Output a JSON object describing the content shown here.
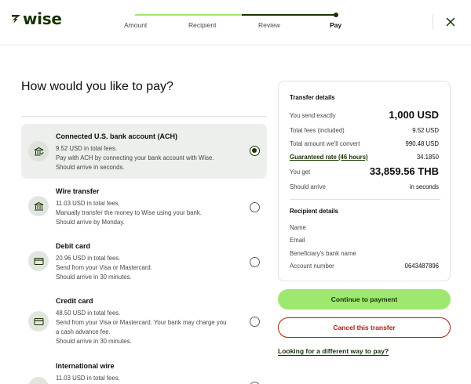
{
  "brand": {
    "name": "wise",
    "accent": "#9fe870",
    "dark": "#163300",
    "danger": "#a8200d"
  },
  "stepper": {
    "steps": [
      {
        "label": "Amount"
      },
      {
        "label": "Recipient"
      },
      {
        "label": "Review"
      },
      {
        "label": "Pay"
      }
    ],
    "active_index": 3
  },
  "close_icon": "close-icon",
  "page": {
    "title": "How would you like to pay?"
  },
  "options": [
    {
      "title": "Connected U.S. bank account (ACH)",
      "lines": [
        "9.52 USD in total fees.",
        "Pay with ACH by connecting your bank account with Wise.",
        "Should arrive in seconds."
      ],
      "icon": "bank-verified-icon",
      "selected": true
    },
    {
      "title": "Wire transfer",
      "lines": [
        "11.03 USD in total fees.",
        "Manually transfer the money to Wise using your bank.",
        "Should arrive by Monday."
      ],
      "icon": "bank-icon",
      "selected": false
    },
    {
      "title": "Debit card",
      "lines": [
        "20.96 USD in total fees.",
        "Send from your Visa or Mastercard.",
        "Should arrive in 30 minutes."
      ],
      "icon": "card-icon",
      "selected": false
    },
    {
      "title": "Credit card",
      "lines": [
        "48.50 USD in total fees.",
        "Send from your Visa or Mastercard. Your bank may charge you",
        "a cash advance fee.",
        "Should arrive in 30 minutes."
      ],
      "icon": "card-icon",
      "selected": false
    },
    {
      "title": "International wire",
      "lines": [
        "11.03 USD in total fees."
      ],
      "icon": "bank-icon",
      "selected": false
    }
  ],
  "transfer_details": {
    "heading": "Transfer details",
    "you_send_label": "You send exactly",
    "you_send_value": "1,000 USD",
    "fees_label": "Total fees (included)",
    "fees_value": "9.52 USD",
    "convert_label": "Total amount we'll convert",
    "convert_value": "990.48 USD",
    "rate_label": "Guaranteed rate (46 hours)",
    "rate_value": "34.1850",
    "you_get_label": "You get",
    "you_get_value": "33,859.56 THB",
    "arrive_label": "Should arrive",
    "arrive_value": "in seconds"
  },
  "recipient_details": {
    "heading": "Recipient details",
    "name_label": "Name",
    "email_label": "Email",
    "bank_label": "Beneficiary's bank name",
    "account_label": "Account number",
    "account_value": "0643487896"
  },
  "actions": {
    "continue_label": "Continue to payment",
    "cancel_label": "Cancel this transfer",
    "alt_link_label": "Looking for a different way to pay?"
  }
}
